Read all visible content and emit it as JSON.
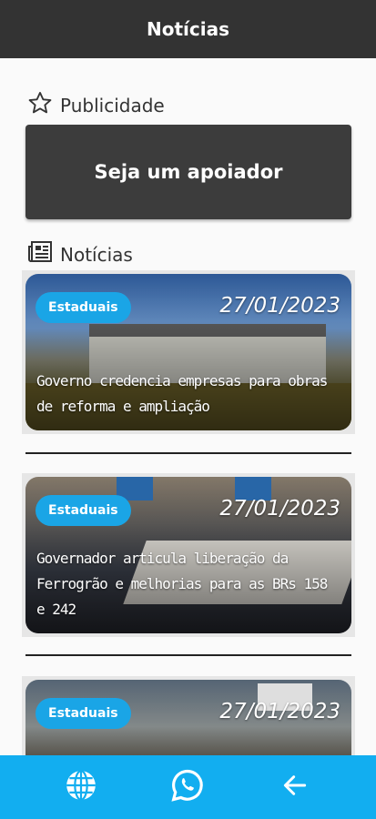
{
  "appbar": {
    "title": "Notícias"
  },
  "publicidade": {
    "label": "Publicidade",
    "icon": "star-outline-icon"
  },
  "support": {
    "label": "Seja um apoiador"
  },
  "news_section": {
    "label": "Notícias",
    "icon": "newspaper-icon"
  },
  "news": [
    {
      "category": "Estaduais",
      "date": "27/01/2023",
      "title": "Governo credencia empresas para obras de reforma e ampliação"
    },
    {
      "category": "Estaduais",
      "date": "27/01/2023",
      "title": "Governador articula liberação da Ferrogrão e melhorias para as BRs 158 e 242"
    },
    {
      "category": "Estaduais",
      "date": "27/01/2023",
      "title": ""
    }
  ],
  "bottom_nav": [
    {
      "icon": "globe-icon"
    },
    {
      "icon": "whatsapp-icon"
    },
    {
      "icon": "arrow-left-icon"
    }
  ],
  "colors": {
    "appbar": "#333333",
    "accent": "#1aa5e6",
    "bottom_bar": "#12aef0"
  }
}
